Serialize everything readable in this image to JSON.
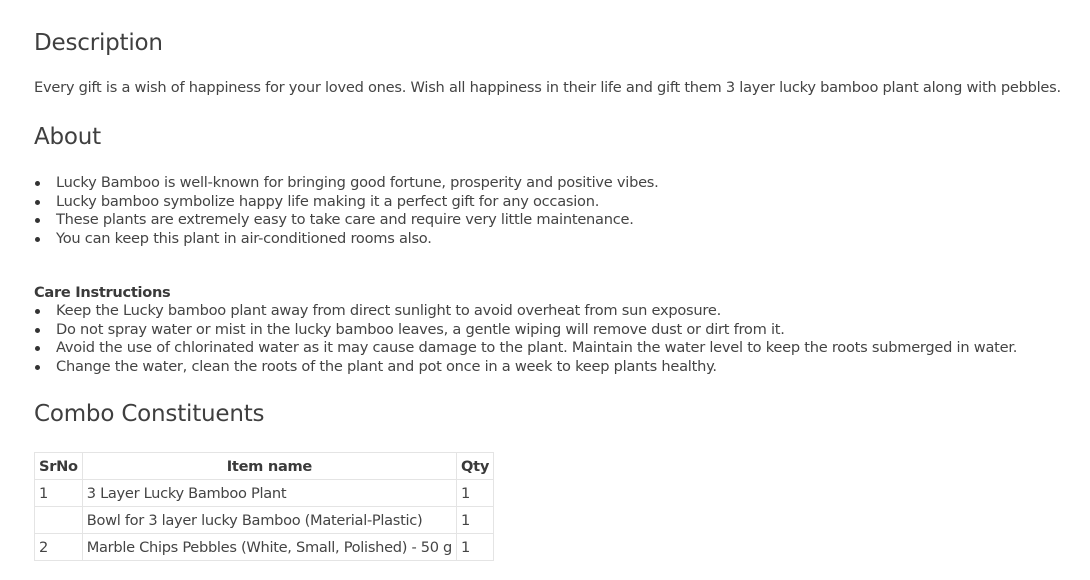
{
  "description": {
    "heading": "Description",
    "text": "Every gift is a wish of happiness for your loved ones. Wish all happiness in their life and gift them 3 layer lucky bamboo plant along with pebbles."
  },
  "about": {
    "heading": "About",
    "items": [
      "Lucky Bamboo is well-known for bringing good fortune, prosperity and positive vibes.",
      "Lucky bamboo symbolize happy life making it a perfect gift for any occasion.",
      "These plants are extremely easy to take care and require very little maintenance.",
      "You can keep this plant in air-conditioned rooms also."
    ]
  },
  "care": {
    "heading": "Care Instructions",
    "items": [
      "Keep the Lucky bamboo plant away from direct sunlight to avoid overheat from sun exposure.",
      "Do not spray water or mist in the lucky bamboo leaves, a gentle wiping will remove dust or dirt from it.",
      "Avoid the use of chlorinated water as it may cause damage to the plant. Maintain the water level to keep the roots submerged in water.",
      "Change the water, clean the roots of the plant and pot once in a week to keep plants healthy."
    ]
  },
  "combo": {
    "heading": "Combo Constituents",
    "columns": [
      "SrNo",
      "Item name",
      "Qty"
    ],
    "rows": [
      [
        "1",
        "3 Layer Lucky Bamboo Plant",
        "1"
      ],
      [
        "",
        "Bowl for 3 layer lucky Bamboo (Material-Plastic)",
        "1"
      ],
      [
        "2",
        "Marble Chips Pebbles (White, Small, Polished) - 50 g",
        "1"
      ]
    ]
  }
}
